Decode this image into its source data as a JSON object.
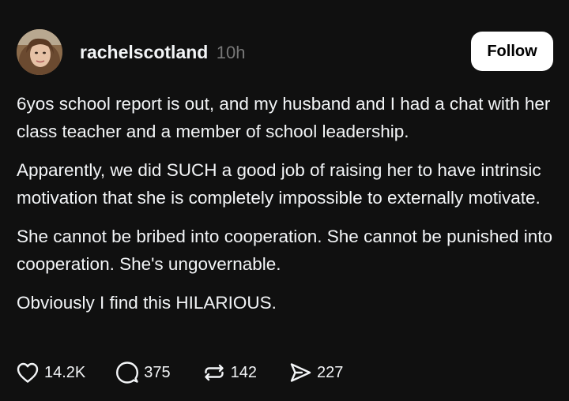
{
  "post": {
    "username": "rachelscotland",
    "timestamp": "10h",
    "follow_label": "Follow",
    "paragraphs": [
      "6yos school report is out, and my husband and I had a chat with her class teacher and a member of school leadership.",
      "Apparently,  we did SUCH a good job of raising her to have intrinsic motivation that she is completely impossible to externally motivate.",
      "She cannot be bribed into cooperation. She cannot be punished into cooperation. She's ungovernable.",
      "Obviously I find this HILARIOUS."
    ],
    "actions": {
      "like": {
        "icon": "heart-icon",
        "count": "14.2K"
      },
      "reply": {
        "icon": "speech-bubble-icon",
        "count": "375"
      },
      "repost": {
        "icon": "repost-icon",
        "count": "142"
      },
      "share": {
        "icon": "send-icon",
        "count": "227"
      }
    }
  },
  "colors": {
    "background": "#101010",
    "text": "#f3f5f7",
    "muted": "#777777",
    "button_bg": "#ffffff",
    "button_text": "#000000"
  }
}
